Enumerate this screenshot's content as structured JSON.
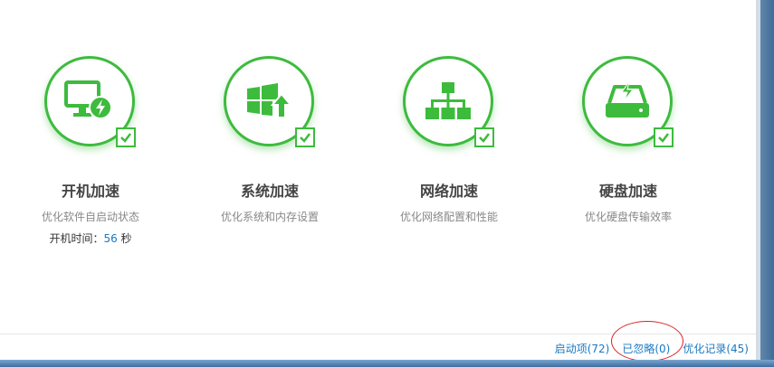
{
  "features": [
    {
      "id": "boot",
      "icon": "monitor-bolt-icon",
      "title": "开机加速",
      "desc": "优化软件自启动状态",
      "extra_label": "开机时间：",
      "extra_value": "56",
      "extra_unit": " 秒",
      "checked": true
    },
    {
      "id": "system",
      "icon": "windows-upgrade-icon",
      "title": "系统加速",
      "desc": "优化系统和内存设置",
      "checked": true
    },
    {
      "id": "network",
      "icon": "network-topology-icon",
      "title": "网络加速",
      "desc": "优化网络配置和性能",
      "checked": true
    },
    {
      "id": "disk",
      "icon": "hard-disk-bolt-icon",
      "title": "硬盘加速",
      "desc": "优化硬盘传输效率",
      "checked": true
    }
  ],
  "footer": {
    "startup_items": "启动项(72)",
    "ignored": "已忽略(0)",
    "history": "优化记录(45)"
  },
  "colors": {
    "accent_green": "#3dbb3d",
    "link_blue": "#1a78c2",
    "highlight_red": "#e02020"
  }
}
